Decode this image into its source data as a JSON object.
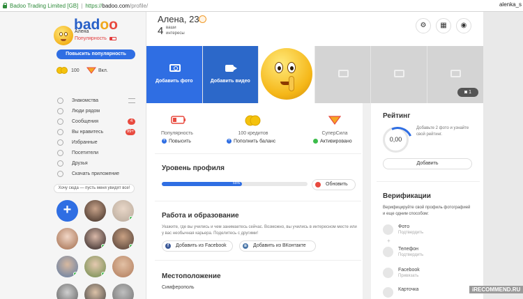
{
  "browser": {
    "org": "Badoo Trading Limited [GB]",
    "url_scheme": "https://",
    "url_host": "badoo.com",
    "url_path": "/profile/",
    "user": "alenka_s"
  },
  "sidebar": {
    "logo": {
      "b": "bad",
      "o1": "o",
      "o2": "o"
    },
    "user_name": "Алена",
    "popularity_label": "Популярность",
    "boost_button": "Повысить популярность",
    "credits": "100",
    "superpower": "Вкл.",
    "menu": [
      {
        "label": "Знакомства",
        "badge": ""
      },
      {
        "label": "Люди рядом",
        "badge": ""
      },
      {
        "label": "Сообщения",
        "badge": "4"
      },
      {
        "label": "Вы нравитесь",
        "badge": "99+"
      },
      {
        "label": "Избранные",
        "badge": ""
      },
      {
        "label": "Посетители",
        "badge": ""
      },
      {
        "label": "Друзья",
        "badge": ""
      },
      {
        "label": "Скачать приложение",
        "badge": ""
      }
    ],
    "want_button": "Хочу сюда — пусть меня увидят все!"
  },
  "profile": {
    "name_age": "Алена, 23",
    "interests_count": "4",
    "interests_label": "ваши интересы"
  },
  "photos": {
    "add_photo": "Добавить фото",
    "add_video": "Добавить видео",
    "count": "1"
  },
  "stats": {
    "popularity": {
      "label": "Популярность",
      "action": "Повысить"
    },
    "credits": {
      "label": "100 кредитов",
      "action": "Пополнить баланс"
    },
    "superpower": {
      "label": "СуперСила",
      "action": "Активировано"
    }
  },
  "profile_level": {
    "title": "Уровень профиля",
    "percent_label": "55%",
    "percent": 55,
    "refresh": "Обновить"
  },
  "work": {
    "title": "Работа и образование",
    "desc": "Укажите, где вы учились и чем занимаетесь сейчас. Возможно, вы учились в интересном месте или у вас необычная карьера. Поделитесь с другими!",
    "facebook": "Добавить из Facebook",
    "vk": "Добавить из ВКонтакте"
  },
  "location": {
    "title": "Местоположение",
    "city": "Симферополь"
  },
  "rating": {
    "title": "Рейтинг",
    "value": "0,00",
    "tip": "Добавьте 2 фото и узнайте свой рейтинг.",
    "add": "Добавить"
  },
  "verification": {
    "title": "Верификации",
    "desc": "Верифицируйте свой профиль фотографией и еще одним способом:",
    "items": [
      {
        "title": "Фото",
        "sub": "Подтвердить"
      },
      {
        "title": "Телефон",
        "sub": "Подтвердить"
      },
      {
        "title": "Facebook",
        "sub": "Привязать"
      },
      {
        "title": "Карточка",
        "sub": ""
      }
    ]
  },
  "watermark": "iRECOMMEND.RU",
  "colors": {
    "accent": "#2f6ee3",
    "danger": "#e84a3f",
    "online": "#3cbc4b"
  }
}
